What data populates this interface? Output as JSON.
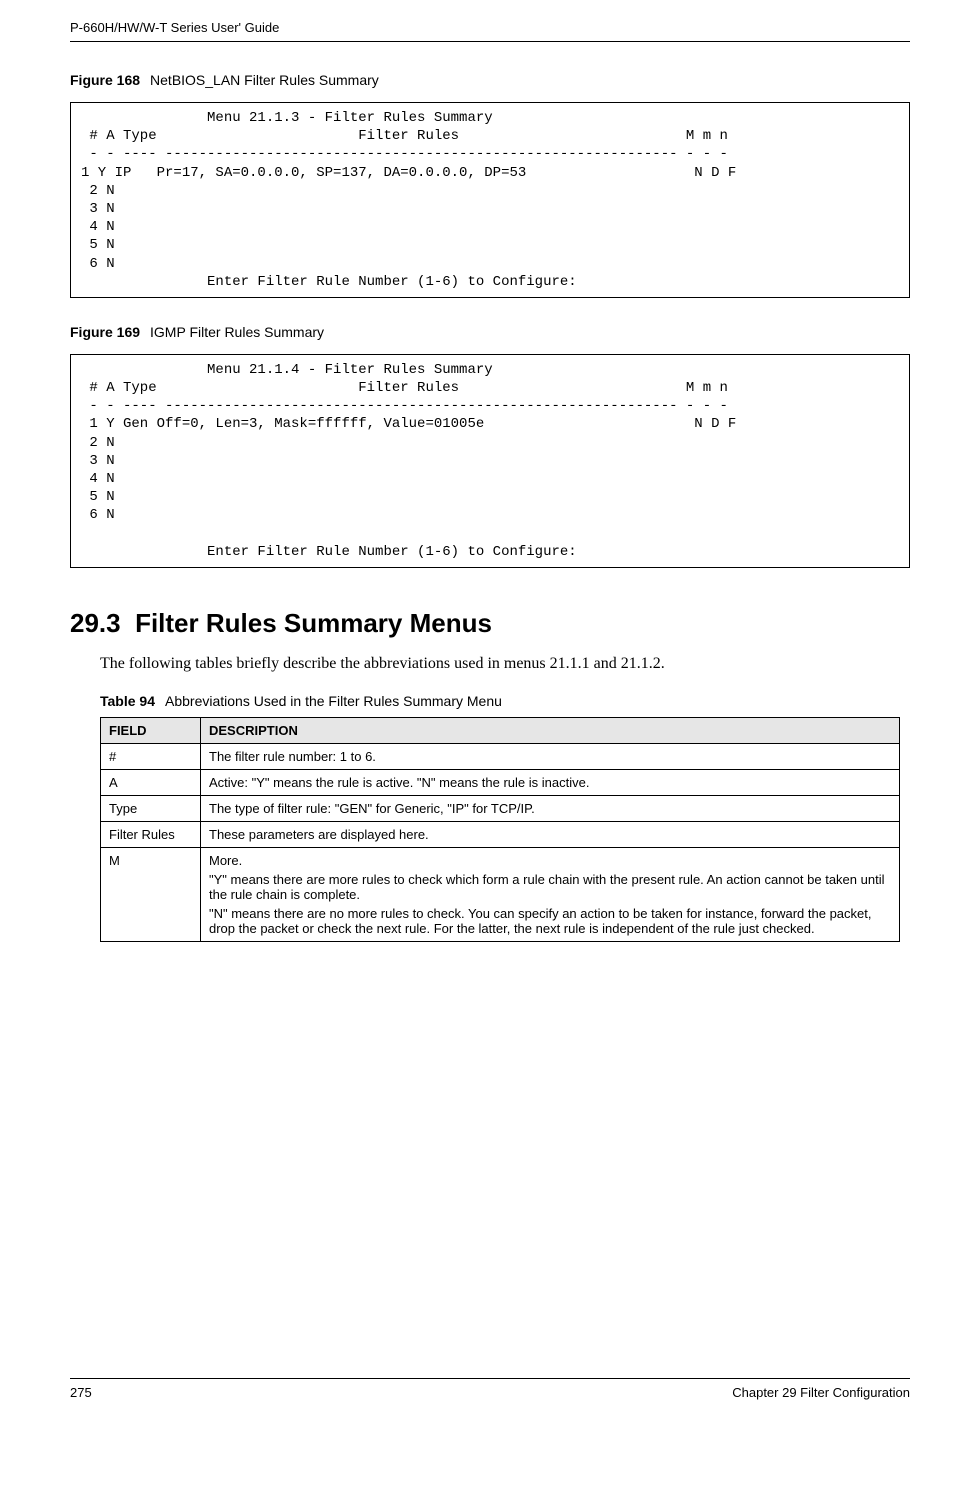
{
  "header": {
    "title": "P-660H/HW/W-T Series User' Guide"
  },
  "figure168": {
    "label": "Figure 168",
    "title": "NetBIOS_LAN Filter Rules Summary",
    "content": "               Menu 21.1.3 - Filter Rules Summary\n # A Type                        Filter Rules                           M m n\n - - ---- ------------------------------------------------------------- - - -\n1 Y IP   Pr=17, SA=0.0.0.0, SP=137, DA=0.0.0.0, DP=53                    N D F\n 2 N\n 3 N\n 4 N\n 5 N\n 6 N\n               Enter Filter Rule Number (1-6) to Configure:"
  },
  "figure169": {
    "label": "Figure 169",
    "title": "IGMP Filter Rules Summary",
    "content": "               Menu 21.1.4 - Filter Rules Summary\n # A Type                        Filter Rules                           M m n\n - - ---- ------------------------------------------------------------- - - -\n 1 Y Gen Off=0, Len=3, Mask=ffffff, Value=01005e                         N D F\n 2 N\n 3 N\n 4 N\n 5 N\n 6 N\n\n               Enter Filter Rule Number (1-6) to Configure:"
  },
  "section": {
    "number": "29.3",
    "title": "Filter Rules Summary Menus",
    "intro": "The following tables briefly describe the abbreviations used in menus 21.1.1 and 21.1.2."
  },
  "table94": {
    "label": "Table 94",
    "title": "Abbreviations Used in the Filter Rules Summary Menu",
    "headers": {
      "field": "FIELD",
      "description": "DESCRIPTION"
    },
    "rows": [
      {
        "field": "#",
        "desc": "The filter rule number: 1 to 6."
      },
      {
        "field": "A",
        "desc": "Active: \"Y\" means the rule is active. \"N\" means the rule is inactive."
      },
      {
        "field": "Type",
        "desc": "The type of filter rule: \"GEN\" for Generic, \"IP\" for TCP/IP."
      },
      {
        "field": "Filter Rules",
        "desc": "These parameters are displayed here."
      },
      {
        "field": "M",
        "desc_multi": [
          "More.",
          "\"Y\" means there are more rules to check which form a rule chain with the present rule. An action cannot be taken until the rule chain is complete.",
          "\"N\" means there are no more rules to check. You can specify an action to be taken for instance, forward the packet, drop the packet or check the next rule. For the latter, the next rule is independent of the rule just checked."
        ]
      }
    ]
  },
  "footer": {
    "page": "275",
    "chapter": "Chapter 29 Filter Configuration"
  }
}
